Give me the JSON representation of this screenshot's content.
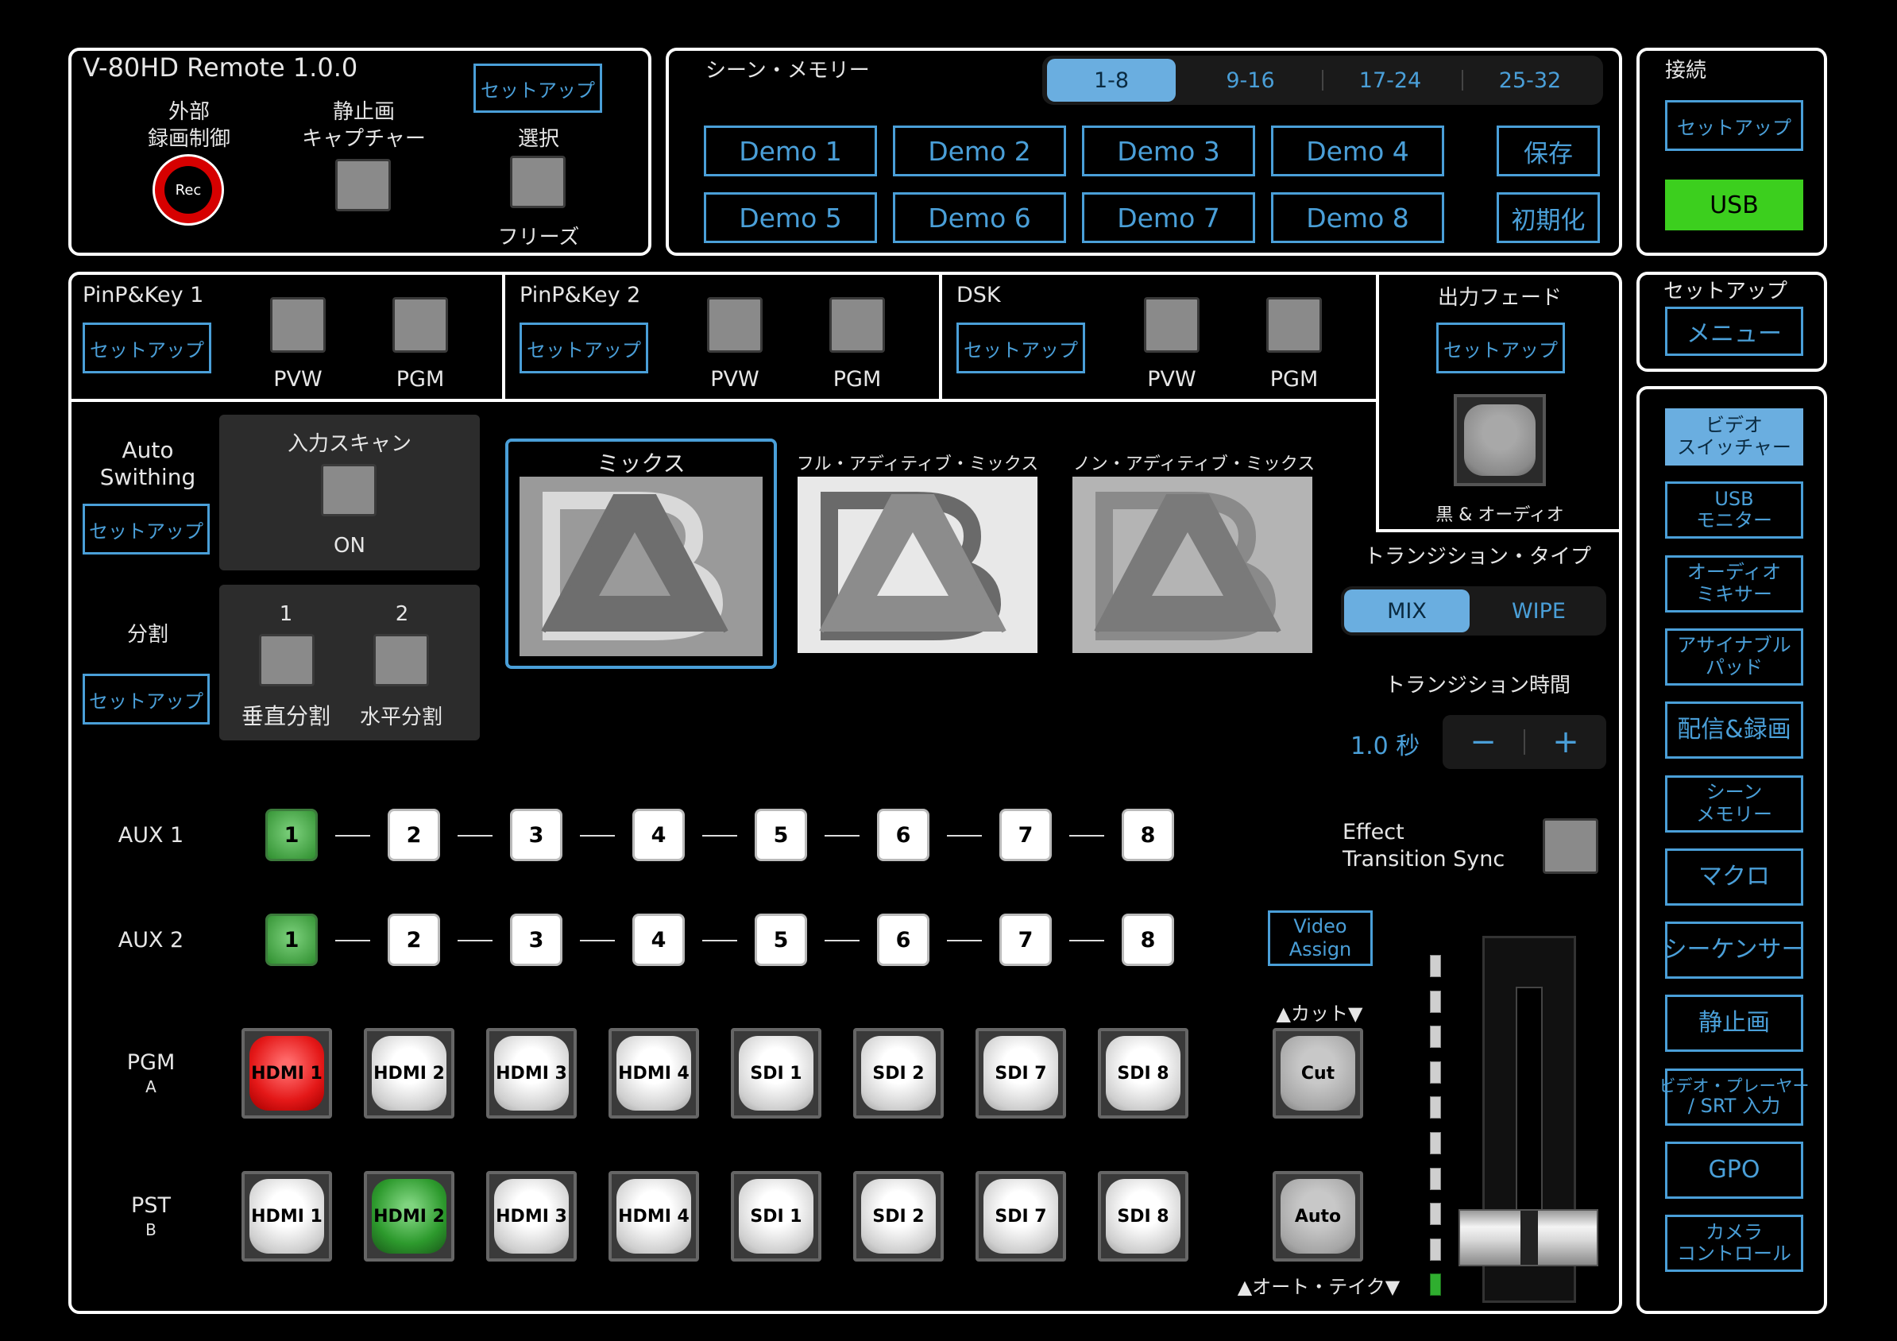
{
  "app": {
    "title": "V-80HD Remote 1.0.0"
  },
  "top_left": {
    "rec_label_line1": "外部",
    "rec_label_line2": "録画制御",
    "rec_button": "Rec",
    "still_label_line1": "静止画",
    "still_label_line2": "キャプチャー",
    "setup": "セットアップ",
    "select_label": "選択",
    "freeze_label": "フリーズ"
  },
  "scene_memory": {
    "title": "シーン・メモリー",
    "banks": [
      "1-8",
      "9-16",
      "17-24",
      "25-32"
    ],
    "scenes": [
      "Demo 1",
      "Demo 2",
      "Demo 3",
      "Demo 4",
      "Demo 5",
      "Demo 6",
      "Demo 7",
      "Demo 8"
    ],
    "save": "保存",
    "init": "初期化"
  },
  "connection": {
    "title": "接続",
    "setup": "セットアップ",
    "status": "USB",
    "status_color": "#3ccf1e"
  },
  "setup_menu": {
    "title": "セットアップ",
    "menu": "メニュー"
  },
  "keys": [
    {
      "title": "PinP&Key 1",
      "setup": "セットアップ",
      "pvw": "PVW",
      "pgm": "PGM"
    },
    {
      "title": "PinP&Key 2",
      "setup": "セットアップ",
      "pvw": "PVW",
      "pgm": "PGM"
    },
    {
      "title": "DSK",
      "setup": "セットアップ",
      "pvw": "PVW",
      "pgm": "PGM"
    }
  ],
  "output_fade": {
    "title": "出力フェード",
    "setup": "セットアップ",
    "label": "黒 & オーディオ"
  },
  "auto_switching": {
    "title_line1": "Auto",
    "title_line2": "Swithing",
    "setup": "セットアップ",
    "scan_label": "入力スキャン",
    "scan_state": "ON"
  },
  "split": {
    "title": "分割",
    "setup": "セットアップ",
    "col1": "1",
    "col2": "2",
    "vertical": "垂直分割",
    "horizontal": "水平分割"
  },
  "mix_types": [
    {
      "label": "ミックス"
    },
    {
      "label": "フル・アディティブ・ミックス"
    },
    {
      "label": "ノン・アディティブ・ミックス"
    }
  ],
  "transition": {
    "type_title": "トランジション・タイプ",
    "mix": "MIX",
    "wipe": "WIPE",
    "time_title": "トランジション時間",
    "time_value": "1.0 秒",
    "minus": "−",
    "plus": "+",
    "effect_sync_line1": "Effect",
    "effect_sync_line2": "Transition Sync"
  },
  "aux": [
    {
      "label": "AUX 1",
      "buttons": [
        "1",
        "2",
        "3",
        "4",
        "5",
        "6",
        "7",
        "8"
      ],
      "active": 0
    },
    {
      "label": "AUX 2",
      "buttons": [
        "1",
        "2",
        "3",
        "4",
        "5",
        "6",
        "7",
        "8"
      ],
      "active": 0
    }
  ],
  "pgm": {
    "label": "PGM",
    "sub": "A",
    "inputs": [
      "HDMI 1",
      "HDMI 2",
      "HDMI 3",
      "HDMI 4",
      "SDI 1",
      "SDI 2",
      "SDI 7",
      "SDI 8"
    ],
    "active": 0
  },
  "pst": {
    "label": "PST",
    "sub": "B",
    "inputs": [
      "HDMI 1",
      "HDMI 2",
      "HDMI 3",
      "HDMI 4",
      "SDI 1",
      "SDI 2",
      "SDI 7",
      "SDI 8"
    ],
    "active": 1
  },
  "video_assign": {
    "line1": "Video",
    "line2": "Assign"
  },
  "cut": {
    "title": "▲カット▼",
    "label": "Cut"
  },
  "auto": {
    "title": "▲オート・テイク▼",
    "label": "Auto"
  },
  "tbar": {
    "position": 0.0
  },
  "side_menu": [
    {
      "line1": "ビデオ",
      "line2": "スイッチャー",
      "active": true
    },
    {
      "line1": "USB",
      "line2": "モニター"
    },
    {
      "line1": "オーディオ",
      "line2": "ミキサー"
    },
    {
      "line1": "アサイナブル",
      "line2": "パッド"
    },
    {
      "line1": "配信&録画",
      "line2": ""
    },
    {
      "line1": "シーン",
      "line2": "メモリー"
    },
    {
      "line1": "マクロ",
      "line2": ""
    },
    {
      "line1": "シーケンサー",
      "line2": ""
    },
    {
      "line1": "静止画",
      "line2": ""
    },
    {
      "line1": "ビデオ・プレーヤー",
      "line2": "/ SRT 入力"
    },
    {
      "line1": "GPO",
      "line2": ""
    },
    {
      "line1": "カメラ",
      "line2": "コントロール"
    }
  ],
  "colors": {
    "accent": "#4a9fd8",
    "accent_fill": "#6aaee0",
    "panel_border": "#ffffff",
    "pgm_red": "#e41818",
    "pst_green": "#2d9a2d"
  }
}
